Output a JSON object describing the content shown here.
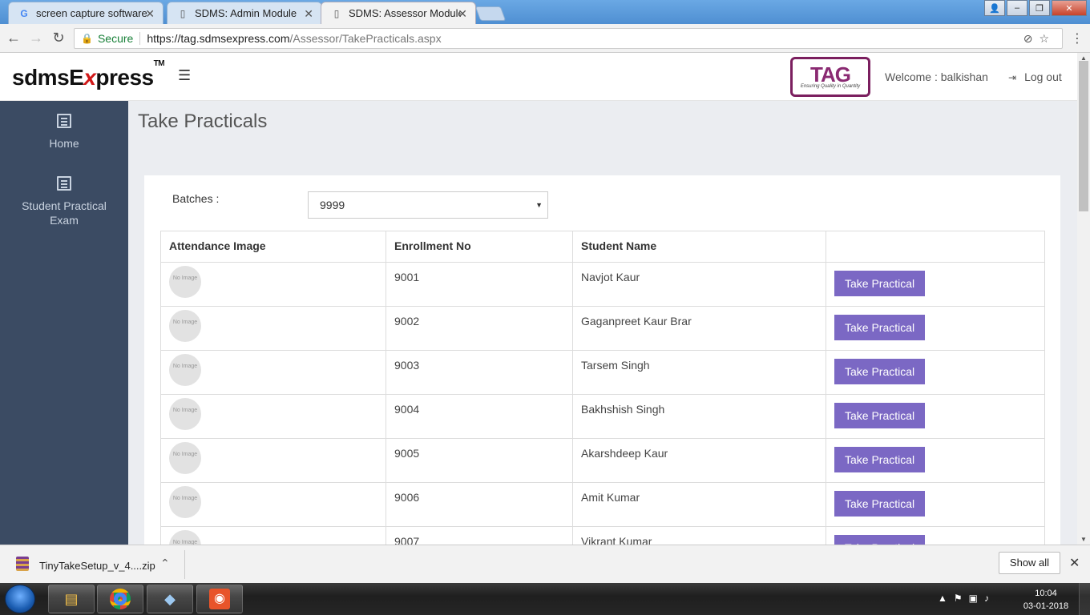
{
  "browser": {
    "tabs": [
      {
        "label": "screen capture software",
        "icon": "google-g-icon",
        "active": false
      },
      {
        "label": "SDMS: Admin Module",
        "icon": "page-icon",
        "active": false
      },
      {
        "label": "SDMS: Assessor Module",
        "icon": "page-icon",
        "active": true
      }
    ],
    "secure_label": "Secure",
    "url_host": "https://tag.sdmsexpress.com",
    "url_path": "/Assessor/TakePracticals.aspx"
  },
  "header": {
    "logo_main": "sdmsE",
    "logo_x": "x",
    "logo_rest": "press",
    "logo_tm": "TM",
    "tag_logo_text": "TAG",
    "tag_logo_sub": "Ensuring Quality in Quantity",
    "welcome": "Welcome : balkishan",
    "logout": "Log out"
  },
  "sidebar": {
    "items": [
      {
        "label": "Home"
      },
      {
        "label": "Student Practical Exam"
      }
    ]
  },
  "main": {
    "title": "Take Practicals",
    "batches_label": "Batches :",
    "batch_selected": "9999",
    "table": {
      "headers": [
        "Attendance Image",
        "Enrollment No",
        "Student Name",
        ""
      ],
      "no_image_text": "No Image",
      "button_label": "Take Practical",
      "rows": [
        {
          "enrollment": "9001",
          "name": "Navjot Kaur"
        },
        {
          "enrollment": "9002",
          "name": "Gaganpreet Kaur Brar"
        },
        {
          "enrollment": "9003",
          "name": "Tarsem Singh"
        },
        {
          "enrollment": "9004",
          "name": "Bakhshish Singh"
        },
        {
          "enrollment": "9005",
          "name": "Akarshdeep Kaur"
        },
        {
          "enrollment": "9006",
          "name": "Amit Kumar"
        },
        {
          "enrollment": "9007",
          "name": "Vikrant Kumar"
        }
      ]
    }
  },
  "downloads": {
    "file": "TinyTakeSetup_v_4....zip",
    "show_all": "Show all"
  },
  "taskbar": {
    "time": "10:04",
    "date": "03-01-2018"
  },
  "colors": {
    "sidebar": "#3b4b63",
    "button": "#7b68c4",
    "main_bg": "#ebedf1"
  }
}
